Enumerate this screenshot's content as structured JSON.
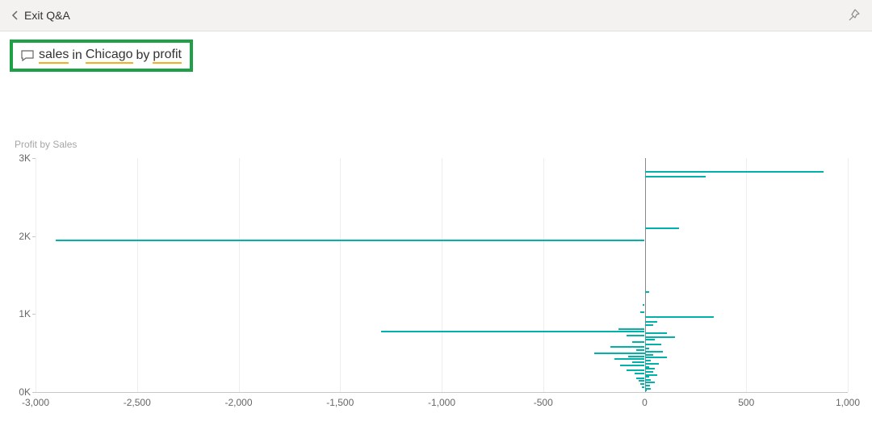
{
  "header": {
    "exit_label": "Exit Q&A"
  },
  "qa": {
    "term1": "sales",
    "word_in": "in",
    "term2": "Chicago",
    "word_by": "by",
    "term3": "profit"
  },
  "chart_data": {
    "type": "bar",
    "title": "Profit by Sales",
    "xlabel": "",
    "ylabel": "",
    "xlim": [
      -3000,
      1000
    ],
    "ylim": [
      0,
      3000
    ],
    "x_ticks": [
      -3000,
      -2500,
      -2000,
      -1500,
      -1000,
      -500,
      0,
      500,
      1000
    ],
    "x_tick_labels": [
      "-3,000",
      "-2,500",
      "-2,000",
      "-1,500",
      "-1,000",
      "-500",
      "0",
      "500",
      "1,000"
    ],
    "y_ticks": [
      0,
      1000,
      2000,
      3000
    ],
    "y_tick_labels": [
      "0K",
      "1K",
      "2K",
      "3K"
    ],
    "series": [
      {
        "name": "Profit",
        "points": [
          {
            "sales": 2820,
            "profit": 880
          },
          {
            "sales": 2760,
            "profit": 300
          },
          {
            "sales": 2100,
            "profit": 170
          },
          {
            "sales": 1940,
            "profit": -2900
          },
          {
            "sales": 1280,
            "profit": 20
          },
          {
            "sales": 1120,
            "profit": -10
          },
          {
            "sales": 1020,
            "profit": -20
          },
          {
            "sales": 960,
            "profit": 340
          },
          {
            "sales": 900,
            "profit": 60
          },
          {
            "sales": 860,
            "profit": 40
          },
          {
            "sales": 810,
            "profit": -130
          },
          {
            "sales": 780,
            "profit": -1300
          },
          {
            "sales": 760,
            "profit": 110
          },
          {
            "sales": 720,
            "profit": -90
          },
          {
            "sales": 700,
            "profit": 150
          },
          {
            "sales": 670,
            "profit": 50
          },
          {
            "sales": 640,
            "profit": -60
          },
          {
            "sales": 610,
            "profit": 80
          },
          {
            "sales": 580,
            "profit": -170
          },
          {
            "sales": 560,
            "profit": 20
          },
          {
            "sales": 540,
            "profit": -40
          },
          {
            "sales": 520,
            "profit": 90
          },
          {
            "sales": 500,
            "profit": -250
          },
          {
            "sales": 480,
            "profit": 40
          },
          {
            "sales": 460,
            "profit": -80
          },
          {
            "sales": 440,
            "profit": 110
          },
          {
            "sales": 420,
            "profit": -150
          },
          {
            "sales": 400,
            "profit": 30
          },
          {
            "sales": 380,
            "profit": -60
          },
          {
            "sales": 360,
            "profit": 70
          },
          {
            "sales": 340,
            "profit": -120
          },
          {
            "sales": 320,
            "profit": 20
          },
          {
            "sales": 300,
            "profit": 50
          },
          {
            "sales": 280,
            "profit": -90
          },
          {
            "sales": 260,
            "profit": 40
          },
          {
            "sales": 240,
            "profit": -50
          },
          {
            "sales": 220,
            "profit": 60
          },
          {
            "sales": 200,
            "profit": 20
          },
          {
            "sales": 180,
            "profit": -40
          },
          {
            "sales": 160,
            "profit": 30
          },
          {
            "sales": 140,
            "profit": -30
          },
          {
            "sales": 120,
            "profit": 50
          },
          {
            "sales": 100,
            "profit": -20
          },
          {
            "sales": 80,
            "profit": 25
          },
          {
            "sales": 60,
            "profit": -15
          },
          {
            "sales": 40,
            "profit": 30
          },
          {
            "sales": 20,
            "profit": 10
          }
        ]
      }
    ]
  },
  "colors": {
    "bar": "#00b2a9",
    "highlight_border": "#1fa046",
    "underline": "#f2b021"
  }
}
